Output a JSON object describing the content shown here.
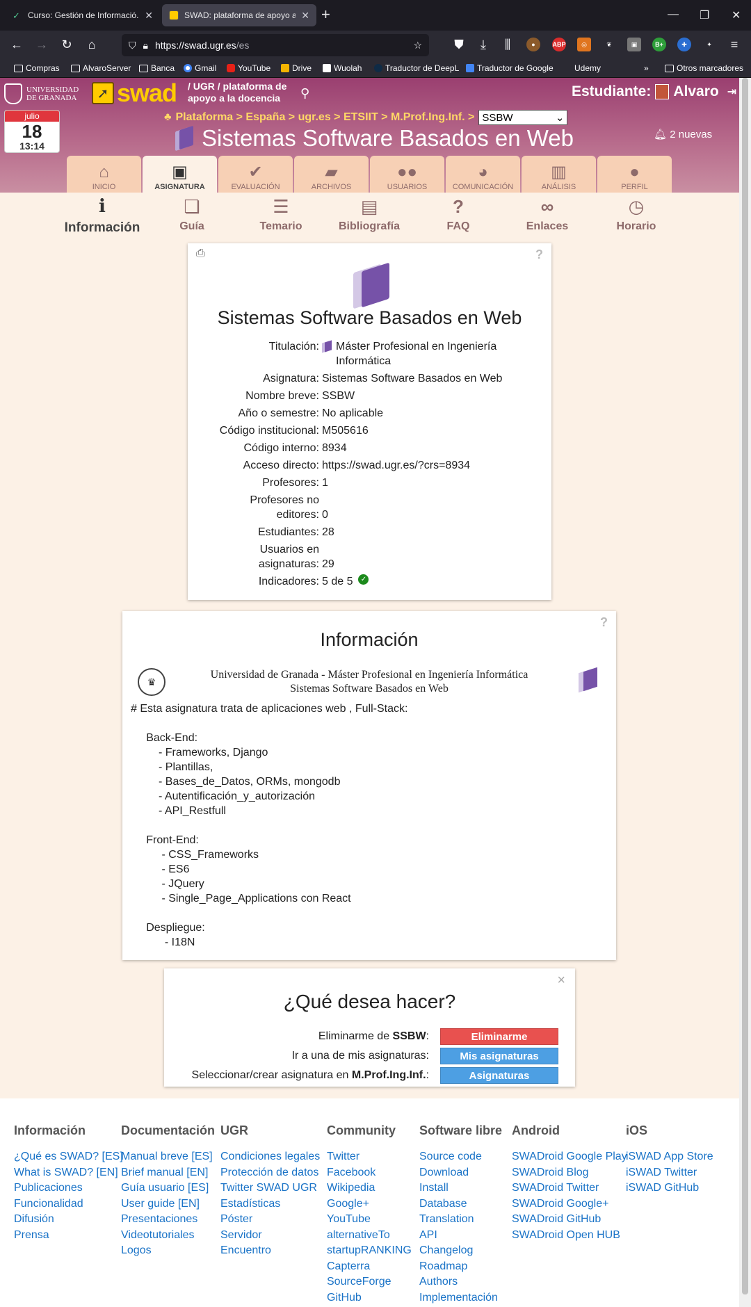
{
  "browser": {
    "tabs": [
      {
        "title": "Curso: Gestión de Informació...",
        "active": false
      },
      {
        "title": "SWAD: plataforma de apoyo a l...",
        "active": true
      }
    ],
    "url_host": "https://swad.ugr.es",
    "url_path": "/es",
    "bookmarks": [
      "Compras",
      "AlvaroServer",
      "Banca",
      "Gmail",
      "YouTube",
      "Drive",
      "Wuolah",
      "Traductor de DeepL",
      "Traductor de Google",
      "Udemy"
    ],
    "other_bookmarks": "Otros marcadores",
    "extensions": {
      "abp": "ABP",
      "badge": "B+"
    }
  },
  "header": {
    "ugr_logo": "UNIVERSIDAD DE GRANADA",
    "logo_text": "swad",
    "tagline_line1": "/ UGR / plataforma de",
    "tagline_line2": "apoyo a la docencia",
    "student_label": "Estudiante:",
    "student_name": "Alvaro",
    "calendar": {
      "month": "julio",
      "day": "18",
      "time": "13:14"
    },
    "breadcrumb": "Plataforma > España > ugr.es > ETSIIT > M.Prof.Ing.Inf. >",
    "course_select": "SSBW",
    "course_title": "Sistemas Software Basados en Web",
    "notifications": "2 nuevas"
  },
  "main_tabs": [
    {
      "label": "INICIO",
      "icon": "home-icon",
      "glyph": "⌂"
    },
    {
      "label": "ASIGNATURA",
      "icon": "course-icon",
      "glyph": "▣"
    },
    {
      "label": "EVALUACIÓN",
      "icon": "check-icon",
      "glyph": "✔"
    },
    {
      "label": "ARCHIVOS",
      "icon": "folder-icon",
      "glyph": "▰"
    },
    {
      "label": "USUARIOS",
      "icon": "users-icon",
      "glyph": "●●"
    },
    {
      "label": "COMUNICACIÓN",
      "icon": "chat-icon",
      "glyph": "◕"
    },
    {
      "label": "ANÁLISIS",
      "icon": "chart-icon",
      "glyph": "▥"
    },
    {
      "label": "PERFIL",
      "icon": "profile-icon",
      "glyph": "●"
    }
  ],
  "sub_menu": [
    {
      "label": "Información",
      "glyph": "i"
    },
    {
      "label": "Guía",
      "glyph": "❏"
    },
    {
      "label": "Temario",
      "glyph": "☰"
    },
    {
      "label": "Bibliografía",
      "glyph": "▤"
    },
    {
      "label": "FAQ",
      "glyph": "?"
    },
    {
      "label": "Enlaces",
      "glyph": "∞"
    },
    {
      "label": "Horario",
      "glyph": "◷"
    }
  ],
  "course_info": {
    "title": "Sistemas Software Basados en Web",
    "rows": [
      {
        "key": "Titulación:",
        "value": "Máster Profesional en Ingeniería Informática"
      },
      {
        "key": "Asignatura:",
        "value": "Sistemas Software Basados en Web"
      },
      {
        "key": "Nombre breve:",
        "value": "SSBW"
      },
      {
        "key": "Año o semestre:",
        "value": "No aplicable"
      },
      {
        "key": "Código institucional:",
        "value": "M505616"
      },
      {
        "key": "Código interno:",
        "value": "8934"
      },
      {
        "key": "Acceso directo:",
        "value": "https://swad.ugr.es/?crs=8934"
      },
      {
        "key": "Profesores:",
        "value": "1"
      },
      {
        "key": "Profesores no editores:",
        "value": "0"
      },
      {
        "key": "Estudiantes:",
        "value": "28"
      },
      {
        "key": "Usuarios en asignaturas:",
        "value": "29"
      },
      {
        "key": "Indicadores:",
        "value": "5 de 5"
      }
    ]
  },
  "information": {
    "title": "Información",
    "university_line": "Universidad de Granada - Máster Profesional en Ingeniería Informática",
    "subject_line": "Sistemas Software Basados en Web",
    "body": "# Esta asignatura trata de aplicaciones web , Full-Stack:\n\n     Back-End:\n         - Frameworks, Django\n         - Plantillas,\n         - Bases_de_Datos, ORMs, mongodb\n         - Autentificación_y_autorización\n         - API_Restfull\n\n     Front-End:\n          - CSS_Frameworks\n          - ES6\n          - JQuery\n          - Single_Page_Applications con React\n\n     Despliegue:\n           - I18N"
  },
  "what_do": {
    "title": "¿Qué desea hacer?",
    "actions": [
      {
        "label_pre": "Eliminarme de ",
        "label_bold": "SSBW",
        "label_post": ":",
        "button": "Eliminarme",
        "color": "#e8514f"
      },
      {
        "label_pre": "Ir a una de mis asignaturas:",
        "label_bold": "",
        "label_post": "",
        "button": "Mis asignaturas",
        "color": "#4d9fe3"
      },
      {
        "label_pre": "Seleccionar/crear asignatura en ",
        "label_bold": "M.Prof.Ing.Inf.",
        "label_post": ":",
        "button": "Asignaturas",
        "color": "#4d9fe3"
      }
    ]
  },
  "footer": [
    {
      "title": "Información",
      "links": [
        "¿Qué es SWAD? [ES]",
        "What is SWAD? [EN]",
        "Publicaciones",
        "Funcionalidad",
        "Difusión",
        "Prensa"
      ]
    },
    {
      "title": "Documentación",
      "links": [
        "Manual breve [ES]",
        "Brief manual [EN]",
        "Guía usuario [ES]",
        "User guide [EN]",
        "Presentaciones",
        "Videotutoriales",
        "Logos"
      ]
    },
    {
      "title": "UGR",
      "links": [
        "Condiciones legales",
        "Protección de datos",
        "Twitter SWAD UGR",
        "Estadísticas",
        "Póster",
        "Servidor",
        "Encuentro"
      ]
    },
    {
      "title": "Community",
      "links": [
        "Twitter",
        "Facebook",
        "Wikipedia",
        "Google+",
        "YouTube",
        "alternativeTo",
        "startupRANKING",
        "Capterra",
        "SourceForge",
        "GitHub"
      ]
    },
    {
      "title": "Software libre",
      "links": [
        "Source code",
        "Download",
        "Install",
        "Database",
        "Translation",
        "API",
        "Changelog",
        "Roadmap",
        "Authors",
        "Implementación"
      ]
    },
    {
      "title": "Android",
      "links": [
        "SWADroid Google Play",
        "SWADroid Blog",
        "SWADroid Twitter",
        "SWADroid Google+",
        "SWADroid GitHub",
        "SWADroid Open HUB"
      ]
    },
    {
      "title": "iOS",
      "links": [
        "iSWAD App Store",
        "iSWAD Twitter",
        "iSWAD GitHub"
      ]
    }
  ],
  "colors": {
    "header_top": "#9a3f70",
    "tab_bg": "#f7d0b5",
    "page_bg": "#fcf1e6",
    "link": "#1a73c7",
    "accent": "#7652a8"
  }
}
